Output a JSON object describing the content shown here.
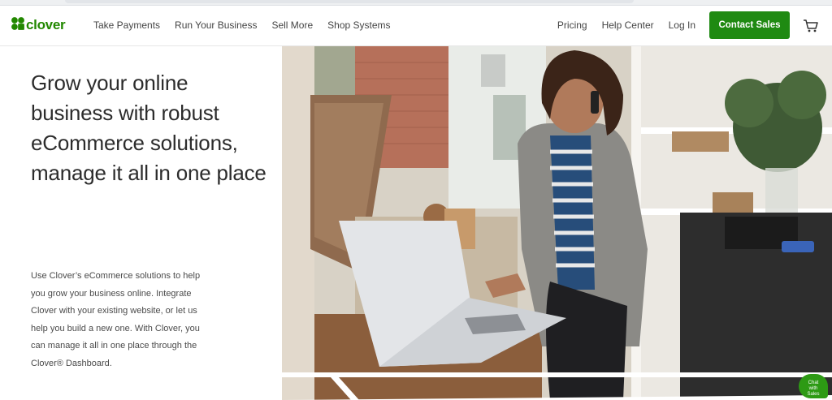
{
  "brand": {
    "logo_text": "clover",
    "accent_color": "#228800",
    "logo_icon": "clover-leaf-icon"
  },
  "nav": {
    "left": [
      {
        "label": "Take Payments"
      },
      {
        "label": "Run Your Business"
      },
      {
        "label": "Sell More"
      },
      {
        "label": "Shop Systems"
      }
    ],
    "right": [
      {
        "label": "Pricing"
      },
      {
        "label": "Help Center"
      },
      {
        "label": "Log In"
      }
    ],
    "cta_label": "Contact Sales",
    "cta_color": "#1f8a12",
    "cart_icon": "shopping-cart-icon"
  },
  "hero": {
    "title": "Grow your online business with robust eCommerce solutions, manage it all in one place",
    "body": "Use Clover’s eCommerce solutions to help you grow your business online. Integrate Clover with your existing website, or let us help you build a new one. With Clover, you can manage it all in one place through the Clover® Dashboard.",
    "image_subject": "woman-on-phone-using-laptop-in-shop"
  },
  "chat": {
    "label_line1": "Chat",
    "label_line2": "with",
    "label_line3": "Sales",
    "icon": "chat-bubble-icon"
  }
}
